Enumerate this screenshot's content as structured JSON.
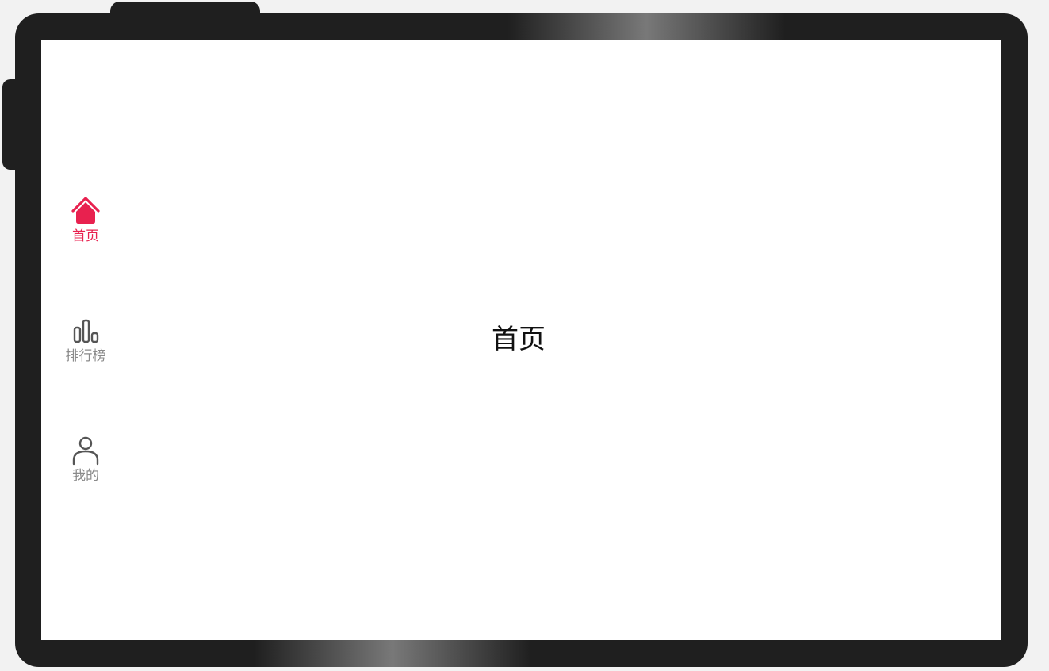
{
  "nav": {
    "items": [
      {
        "label": "首页",
        "icon": "home-icon",
        "active": true
      },
      {
        "label": "排行榜",
        "icon": "bar-chart-icon",
        "active": false
      },
      {
        "label": "我的",
        "icon": "person-icon",
        "active": false
      }
    ],
    "active_color": "#e8214f",
    "inactive_color": "#8a8a8a"
  },
  "main": {
    "title": "首页"
  }
}
